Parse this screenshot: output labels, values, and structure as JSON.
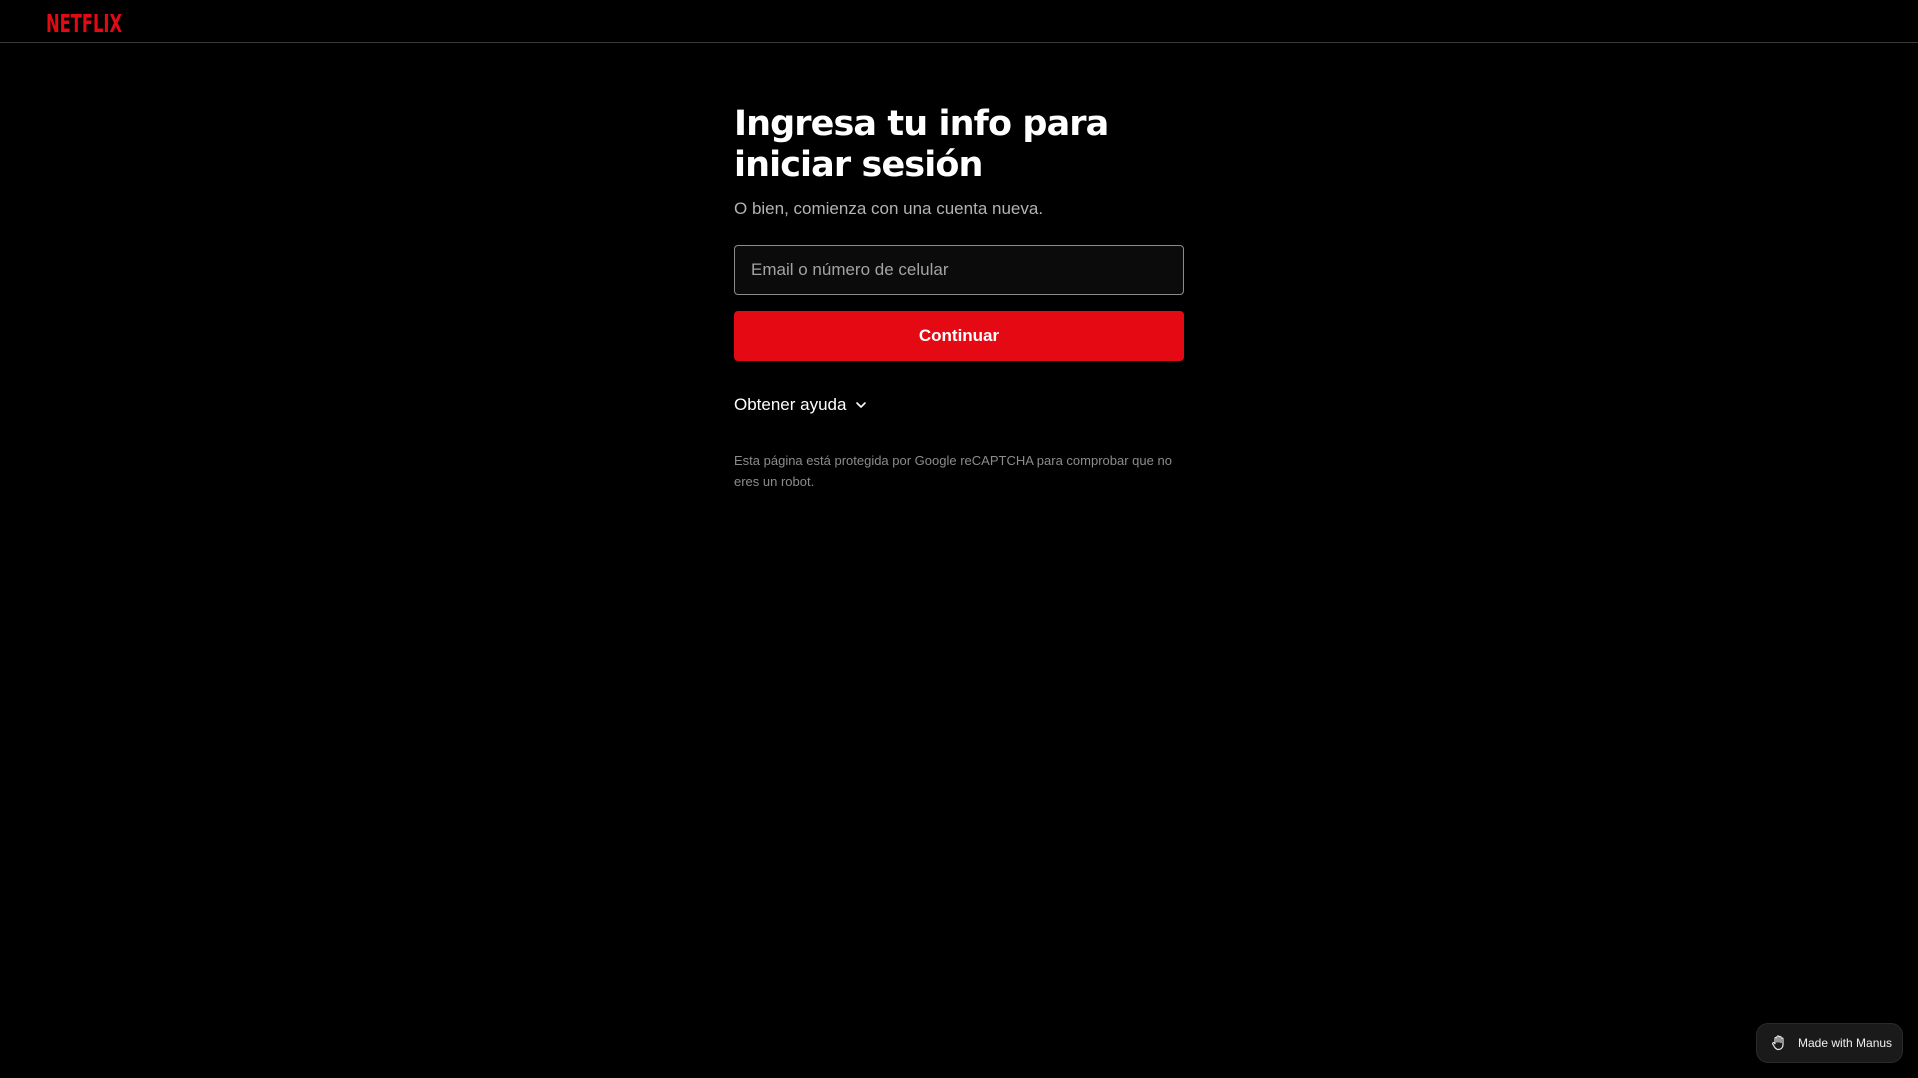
{
  "header": {
    "logo_text": "NETFLIX",
    "brand_color": "#e50914"
  },
  "main": {
    "title": "Ingresa tu info para iniciar sesión",
    "subtitle": "O bien, comienza con una cuenta nueva.",
    "email_input": {
      "value": "",
      "placeholder": "Email o número de celular"
    },
    "continue_label": "Continuar",
    "help_label": "Obtener ayuda",
    "help_icon": "chevron-down-icon",
    "recaptcha_text": "Esta página está protegida por Google reCAPTCHA para comprobar que no eres un robot."
  },
  "badge": {
    "label": "Made with Manus",
    "icon": "manus-hand-icon"
  },
  "colors": {
    "background": "#000000",
    "accent": "#e50914",
    "muted_text": "#b3b3b3",
    "fine_print": "#8c8c8c"
  }
}
